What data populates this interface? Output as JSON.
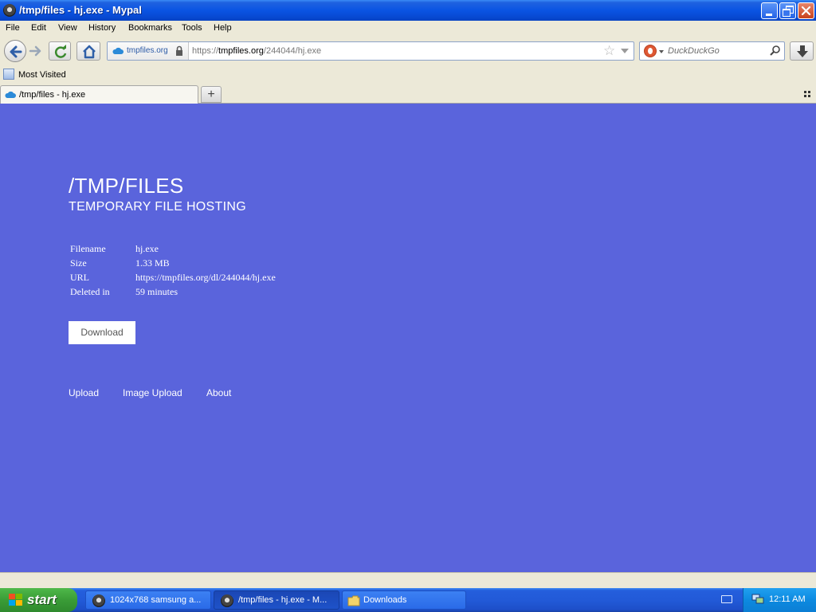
{
  "window": {
    "title": "/tmp/files - hj.exe - Mypal"
  },
  "menu": {
    "items": [
      "File",
      "Edit",
      "View",
      "History",
      "Bookmarks",
      "Tools",
      "Help"
    ]
  },
  "navbar": {
    "identity_site": "tmpfiles.org",
    "url_prefix": "https://",
    "url_host": "tmpfiles.org",
    "url_path": "/244044/hj.exe",
    "search_placeholder": "DuckDuckGo"
  },
  "bookmarks": {
    "items": [
      "Most Visited"
    ]
  },
  "tabs": [
    {
      "label": "/tmp/files - hj.exe"
    }
  ],
  "page": {
    "title": "/TMP/FILES",
    "subtitle": "TEMPORARY FILE HOSTING",
    "info": [
      {
        "key": "Filename",
        "value": "hj.exe"
      },
      {
        "key": "Size",
        "value": "1.33 MB"
      },
      {
        "key": "URL",
        "value": "https://tmpfiles.org/dl/244044/hj.exe"
      },
      {
        "key": "Deleted in",
        "value": "59 minutes"
      }
    ],
    "download_label": "Download",
    "footer_links": [
      "Upload",
      "Image Upload",
      "About"
    ]
  },
  "taskbar": {
    "start_label": "start",
    "tasks": [
      {
        "label": "1024x768 samsung a..."
      },
      {
        "label": "/tmp/files - hj.exe - M..."
      },
      {
        "label": "Downloads"
      }
    ],
    "clock": "12:11 AM"
  },
  "colors": {
    "page_background": "#5a64dc",
    "title_bar": "#0a54e3",
    "taskbar": "#225ad8",
    "start_button": "#3a9c37"
  }
}
